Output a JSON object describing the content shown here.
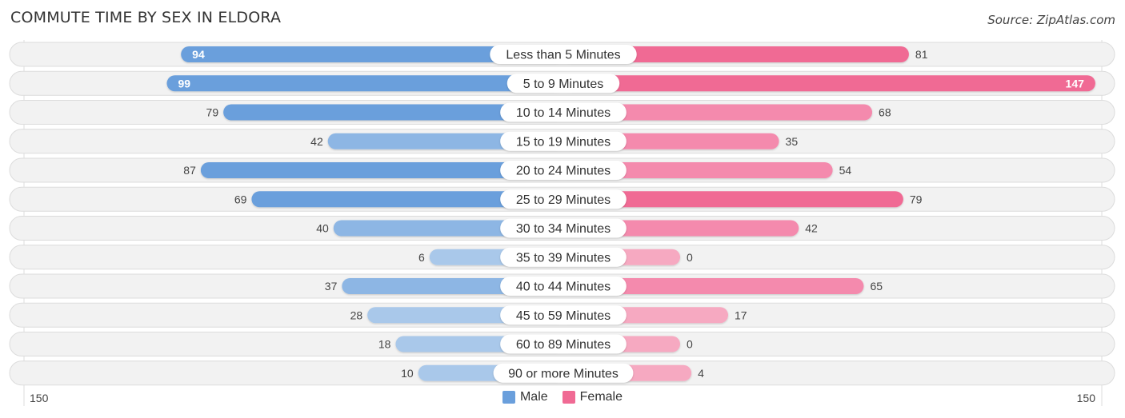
{
  "header": {
    "title": "COMMUTE TIME BY SEX IN ELDORA",
    "source": "Source: ZipAtlas.com"
  },
  "legend": {
    "male_label": "Male",
    "female_label": "Female"
  },
  "axis": {
    "left_label": "150",
    "right_label": "150"
  },
  "colors": {
    "male_strong": "#6a9fdc",
    "male_light": "#a9c8ea",
    "female_strong": "#f06a94",
    "female_light": "#f6a9c1",
    "row_bg": "#f2f2f2"
  },
  "chart_data": {
    "type": "bar",
    "orientation": "horizontal-diverging",
    "title": "COMMUTE TIME BY SEX IN ELDORA",
    "xlabel": "",
    "ylabel": "",
    "xlim": [
      150,
      150
    ],
    "legend_position": "bottom-center",
    "categories": [
      "Less than 5 Minutes",
      "5 to 9 Minutes",
      "10 to 14 Minutes",
      "15 to 19 Minutes",
      "20 to 24 Minutes",
      "25 to 29 Minutes",
      "30 to 34 Minutes",
      "35 to 39 Minutes",
      "40 to 44 Minutes",
      "45 to 59 Minutes",
      "60 to 89 Minutes",
      "90 or more Minutes"
    ],
    "series": [
      {
        "name": "Male",
        "values": [
          94,
          99,
          79,
          42,
          87,
          69,
          40,
          6,
          37,
          28,
          18,
          10
        ]
      },
      {
        "name": "Female",
        "values": [
          81,
          147,
          68,
          35,
          54,
          79,
          42,
          0,
          65,
          17,
          0,
          4
        ]
      }
    ]
  }
}
